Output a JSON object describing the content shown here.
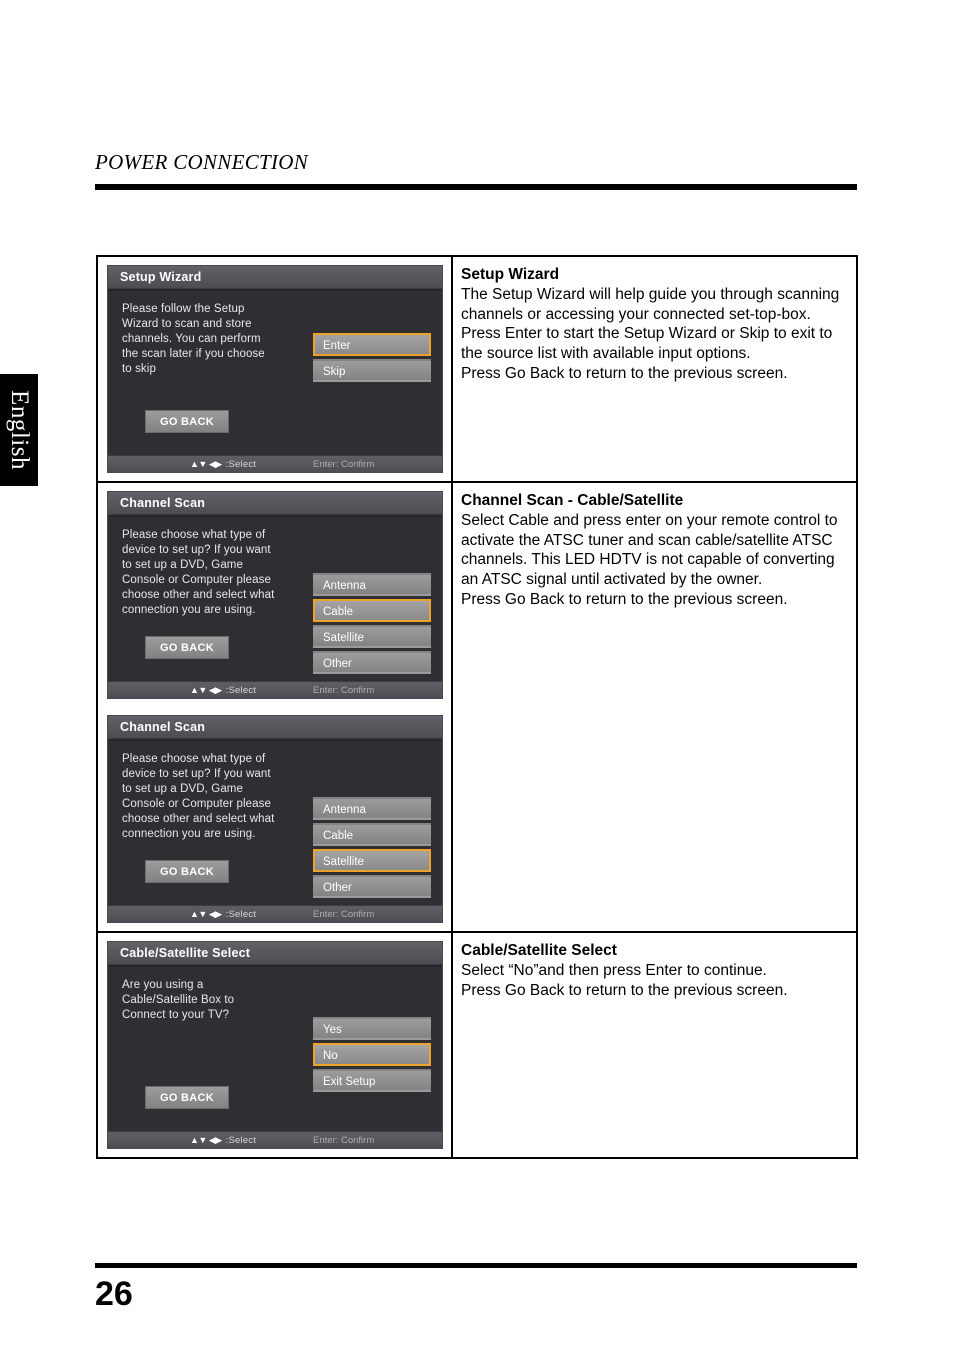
{
  "language_tab": "English",
  "header": {
    "title": "POWER CONNECTION"
  },
  "footer": {
    "page_number": "26"
  },
  "osd_footer": {
    "arrows": "▲▼ ◀▶",
    "select_label": ":Select",
    "confirm_label": "Enter: Confirm"
  },
  "go_back_label": "GO BACK",
  "colors": {
    "highlight": "#eda32a",
    "osd_background": "#2f2f33",
    "osd_header": "#56565d",
    "button": "#909090"
  },
  "rows": [
    {
      "screens": [
        {
          "title": "Setup Wizard",
          "body": "Please follow the Setup\nWizard to scan and store\nchannels.  You can perform\nthe scan later if you choose\nto skip",
          "options": [
            {
              "label": "Enter",
              "selected": true
            },
            {
              "label": "Skip",
              "selected": false
            }
          ]
        }
      ],
      "description": {
        "title": "Setup Wizard",
        "body": "The Setup Wizard will help guide you through scanning channels or accessing your connected set-top-box. Press Enter to start the Setup Wizard or Skip to exit to the source list with available input options.\nPress Go Back to return to the previous screen."
      }
    },
    {
      "screens": [
        {
          "title": "Channel Scan",
          "body": "Please choose what type of\ndevice to set up? If you want\nto set up a DVD, Game\nConsole or Computer please\nchoose other and select what\nconnection you are using.",
          "options": [
            {
              "label": "Antenna",
              "selected": false
            },
            {
              "label": "Cable",
              "selected": true
            },
            {
              "label": "Satellite",
              "selected": false
            },
            {
              "label": "Other",
              "selected": false
            }
          ]
        },
        {
          "title": "Channel Scan",
          "body": "Please choose what type of\ndevice to set up? If you want\nto set up a DVD, Game\nConsole or Computer please\nchoose other and select what\nconnection you are using.",
          "options": [
            {
              "label": "Antenna",
              "selected": false
            },
            {
              "label": "Cable",
              "selected": false
            },
            {
              "label": "Satellite",
              "selected": true
            },
            {
              "label": "Other",
              "selected": false
            }
          ]
        }
      ],
      "description": {
        "title": "Channel Scan - Cable/Satellite",
        "body": "Select Cable and press enter on your remote control to activate the ATSC tuner and scan cable/satellite ATSC channels. This LED HDTV is not capable of converting an ATSC signal until activated by the owner.\nPress Go Back to return to the previous screen."
      }
    },
    {
      "screens": [
        {
          "title": "Cable/Satellite Select",
          "body": "Are you using a\nCable/Satellite Box to\nConnect to your TV?",
          "options": [
            {
              "label": "Yes",
              "selected": false
            },
            {
              "label": "No",
              "selected": true
            },
            {
              "label": "Exit Setup",
              "selected": false
            }
          ]
        }
      ],
      "description": {
        "title": "Cable/Satellite Select",
        "body": "Select “No”and then press Enter to continue.\nPress Go Back to return to the previous screen."
      }
    }
  ]
}
